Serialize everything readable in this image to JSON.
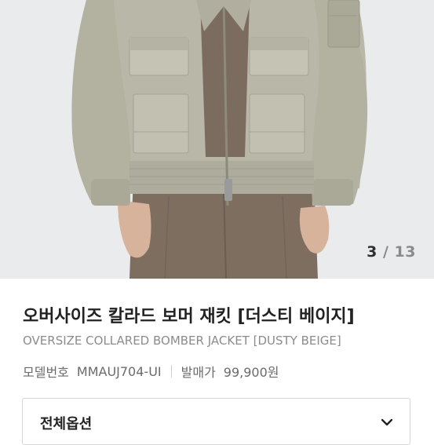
{
  "product": {
    "image_counter": {
      "current": "3",
      "separator": "/",
      "total": "13"
    },
    "title": "오버사이즈 칼라드 보머 재킷 [더스티 베이지]",
    "subtitle": "OVERSIZE COLLARED BOMBER JACKET [DUSTY BEIGE]",
    "model_label": "모델번호",
    "model_value": "MMAUJ704-UI",
    "release_label": "발매가",
    "release_value": "99,900원",
    "options_label": "전체옵션"
  },
  "colors": {
    "jacket": "#b9b8a8",
    "pants": "#7e6e60",
    "background": "#e9ebec"
  },
  "icons": [
    "chevron-down-icon"
  ]
}
